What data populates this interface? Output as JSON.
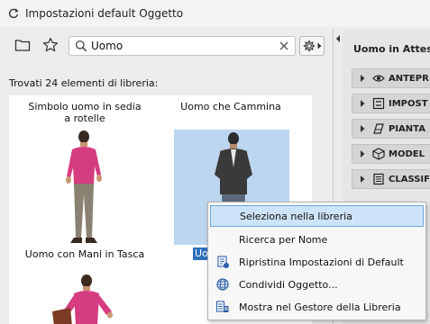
{
  "window": {
    "title": "Impostazioni default Oggetto"
  },
  "search": {
    "value": "Uomo"
  },
  "results": {
    "count_text": "Trovati 24 elementi di libreria:"
  },
  "library": {
    "items": [
      {
        "label": "Simbolo uomo in sedia a rotelle"
      },
      {
        "label": "Uomo che Cammina"
      },
      {
        "label": "Uomo con Mani in Tasca"
      },
      {
        "label": "Uo"
      }
    ]
  },
  "right_panel": {
    "title": "Uomo in Attesa",
    "sections": [
      {
        "label": "ANTEPR",
        "icon": "eye-icon"
      },
      {
        "label": "IMPOST",
        "icon": "settings-icon"
      },
      {
        "label": "PIANTA",
        "icon": "floorplan-icon"
      },
      {
        "label": "MODEL",
        "icon": "cube-icon"
      },
      {
        "label": "CLASSIF",
        "icon": "list-icon"
      }
    ]
  },
  "context_menu": {
    "items": [
      {
        "label": "Seleziona nella libreria",
        "icon": ""
      },
      {
        "label": "Ricerca per Nome",
        "icon": ""
      },
      {
        "label": "Ripristina Impostazioni di Default",
        "icon": "reset-icon"
      },
      {
        "label": "Condividi Oggetto...",
        "icon": "globe-icon"
      },
      {
        "label": "Mostra nel Gestore della Libreria",
        "icon": "library-manager-icon"
      }
    ]
  },
  "colors": {
    "accent": "#cde3f7",
    "highlight_border": "#6ea7d9",
    "selected_thumb": "#bcd6f0",
    "shirt_pink": "#d63c80",
    "jacket_dark": "#3a3a3a"
  }
}
